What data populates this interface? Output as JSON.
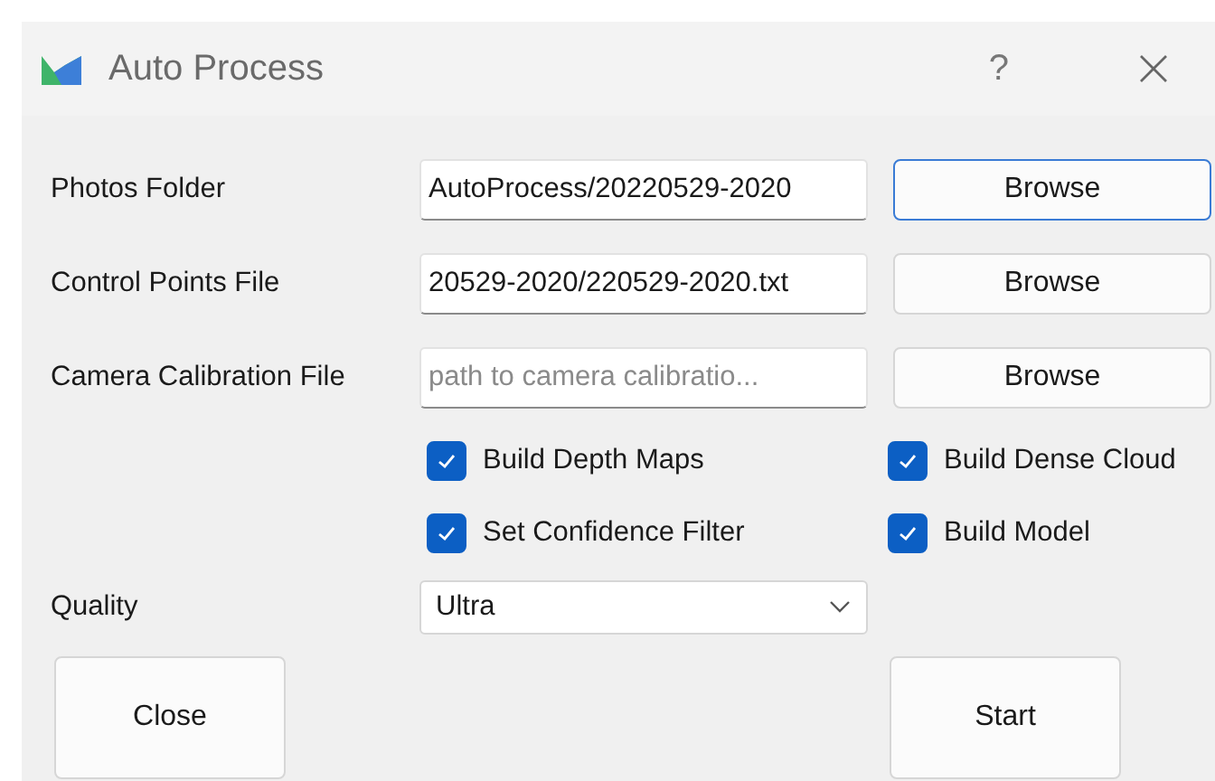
{
  "window": {
    "title": "Auto Process",
    "help": "?"
  },
  "file_rows": [
    {
      "label": "Photos Folder",
      "value": "AutoProcess/20220529-2020",
      "button": "Browse",
      "focused": true
    },
    {
      "label": "Control Points File",
      "value": "20529-2020/220529-2020.txt",
      "button": "Browse",
      "focused": false
    },
    {
      "label": "Camera Calibration File",
      "placeholder": "path to camera calibratio...",
      "button": "Browse",
      "focused": false
    }
  ],
  "options": [
    {
      "label": "Build Depth Maps",
      "checked": true
    },
    {
      "label": "Build Dense Cloud",
      "checked": true
    },
    {
      "label": "Set Confidence Filter",
      "checked": true
    },
    {
      "label": "Build Model",
      "checked": true
    }
  ],
  "quality": {
    "label": "Quality",
    "value": "Ultra"
  },
  "buttons": [
    "Close",
    "Start"
  ]
}
